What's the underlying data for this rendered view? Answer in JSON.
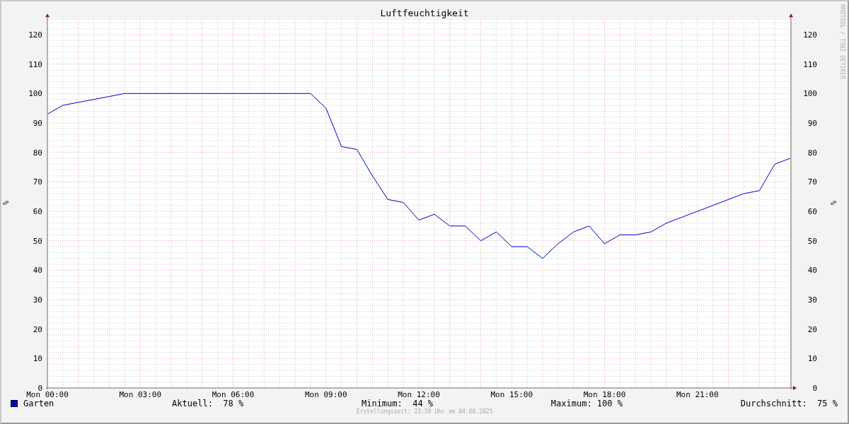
{
  "chart": {
    "chart_data": {
      "type": "line",
      "title": "Luftfeuchtigkeit",
      "ylabel": "%",
      "categories": [
        "Mon 00:00",
        null,
        null,
        null,
        null,
        null,
        "Mon 03:00",
        null,
        null,
        null,
        null,
        null,
        "Mon 06:00",
        null,
        null,
        null,
        null,
        null,
        "Mon 09:00",
        null,
        null,
        null,
        null,
        null,
        "Mon 12:00",
        null,
        null,
        null,
        null,
        null,
        "Mon 15:00",
        null,
        null,
        null,
        null,
        null,
        "Mon 18:00",
        null,
        null,
        null,
        null,
        null,
        "Mon 21:00",
        null,
        null,
        null,
        null,
        null,
        null
      ],
      "series": [
        {
          "name": "Garten",
          "color": "#0000cc",
          "values": [
            93,
            96,
            97,
            98,
            99,
            100,
            100,
            100,
            100,
            100,
            100,
            100,
            100,
            100,
            100,
            100,
            100,
            100,
            95,
            82,
            81,
            72,
            64,
            63,
            57,
            59,
            55,
            55,
            50,
            53,
            48,
            48,
            44,
            49,
            53,
            55,
            49,
            52,
            52,
            53,
            56,
            58,
            60,
            62,
            64,
            66,
            67,
            76,
            78
          ]
        }
      ],
      "ylim": [
        0,
        125
      ],
      "grid": true,
      "yticks": [
        0,
        10,
        20,
        30,
        40,
        50,
        60,
        70,
        80,
        90,
        100,
        110,
        120
      ]
    },
    "right_axis": {
      "label": "%",
      "ticks": [
        "120",
        "110",
        "100",
        "90",
        "80",
        "70",
        "60",
        "50",
        "40",
        "30",
        "20",
        "10",
        "0"
      ]
    },
    "credit": "RRDTOOL / TOBI OETIKER"
  },
  "legend": {
    "stats": [
      "Aktuell:  78 %",
      "Minimum:  44 %",
      "Maximum: 100 %",
      "Durchschnitt:  75 %"
    ]
  },
  "footer": "Erstellungszeit: 23:58 Uhr am 04.08.2025"
}
